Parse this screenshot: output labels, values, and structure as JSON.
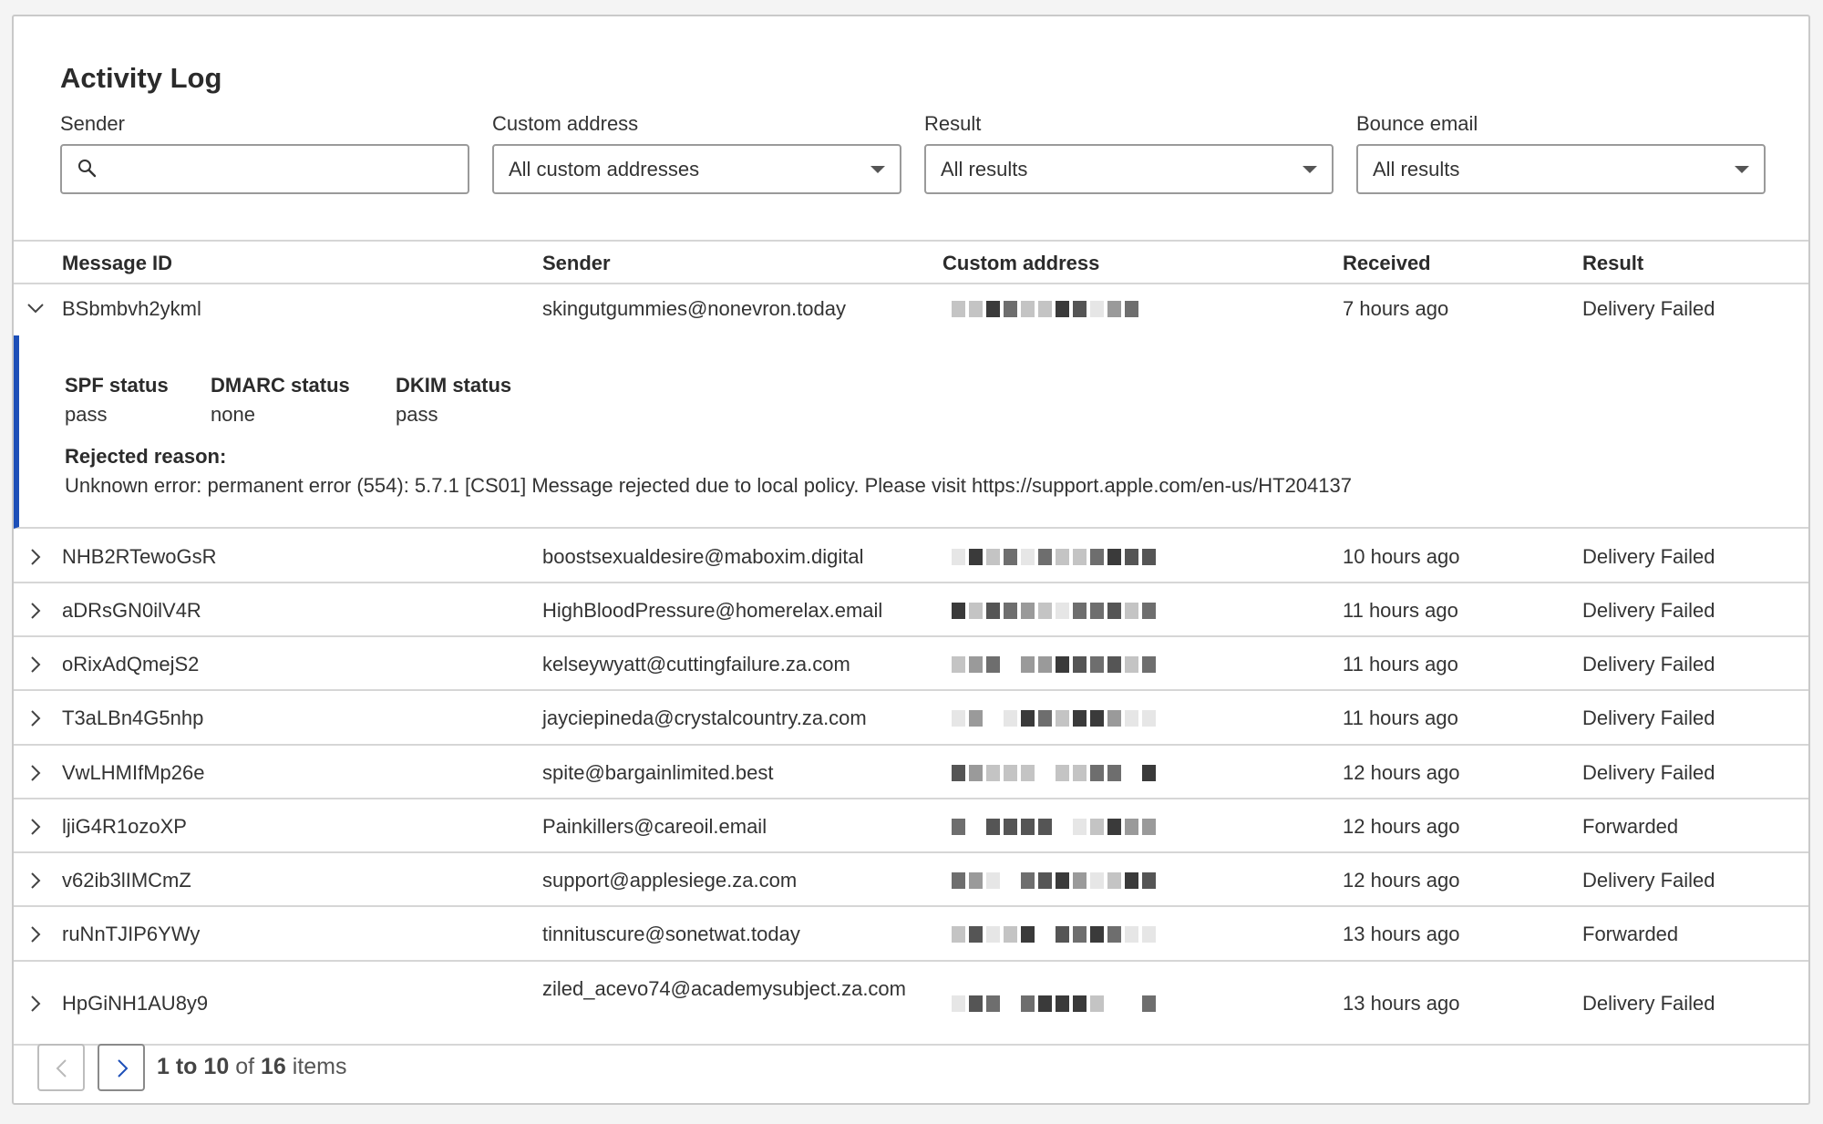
{
  "page": {
    "title": "Activity Log"
  },
  "filters": {
    "sender": {
      "label": "Sender",
      "value": ""
    },
    "custom_address": {
      "label": "Custom address",
      "value": "All custom addresses"
    },
    "result": {
      "label": "Result",
      "value": "All results"
    },
    "bounce_email": {
      "label": "Bounce email",
      "value": "All results"
    }
  },
  "table": {
    "headers": {
      "message_id": "Message ID",
      "sender": "Sender",
      "custom_address": "Custom address",
      "received": "Received",
      "result": "Result"
    },
    "rows": [
      {
        "id": "BSbmbvh2ykml",
        "sender": "skingutgummies@nonevron.today",
        "received": "7 hours ago",
        "result": "Delivery Failed"
      },
      {
        "id": "NHB2RTewoGsR",
        "sender": "boostsexualdesire@maboxim.digital",
        "received": "10 hours ago",
        "result": "Delivery Failed"
      },
      {
        "id": "aDRsGN0ilV4R",
        "sender": "HighBloodPressure@homerelax.email",
        "received": "11 hours ago",
        "result": "Delivery Failed"
      },
      {
        "id": "oRixAdQmejS2",
        "sender": "kelseywyatt@cuttingfailure.za.com",
        "received": "11 hours ago",
        "result": "Delivery Failed"
      },
      {
        "id": "T3aLBn4G5nhp",
        "sender": "jayciepineda@crystalcountry.za.com",
        "received": "11 hours ago",
        "result": "Delivery Failed"
      },
      {
        "id": "VwLHMIfMp26e",
        "sender": "spite@bargainlimited.best",
        "received": "12 hours ago",
        "result": "Delivery Failed"
      },
      {
        "id": "ljiG4R1ozoXP",
        "sender": "Painkillers@careoil.email",
        "received": "12 hours ago",
        "result": "Forwarded"
      },
      {
        "id": "v62ib3lIMCmZ",
        "sender": "support@applesiege.za.com",
        "received": "12 hours ago",
        "result": "Delivery Failed"
      },
      {
        "id": "ruNnTJIP6YWy",
        "sender": "tinnituscure@sonetwat.today",
        "received": "13 hours ago",
        "result": "Forwarded"
      },
      {
        "id": "HpGiNH1AU8y9",
        "sender": "ziled_acevo74@academysubject.za.com",
        "received": "13 hours ago",
        "result": "Delivery Failed"
      }
    ]
  },
  "details": {
    "spf_label": "SPF status",
    "spf_value": "pass",
    "dmarc_label": "DMARC status",
    "dmarc_value": "none",
    "dkim_label": "DKIM status",
    "dkim_value": "pass",
    "rejected_label": "Rejected reason:",
    "rejected_value": "Unknown error: permanent error (554): 5.7.1 [CS01] Message rejected due to local policy. Please visit https://support.apple.com/en-us/HT204137"
  },
  "pagination": {
    "range_start": "1",
    "to": "to",
    "range_end": "10",
    "of": "of",
    "total": "16",
    "items": "items"
  },
  "colors": {
    "accent": "#1d4fb8",
    "border": "#d6d6d6"
  }
}
